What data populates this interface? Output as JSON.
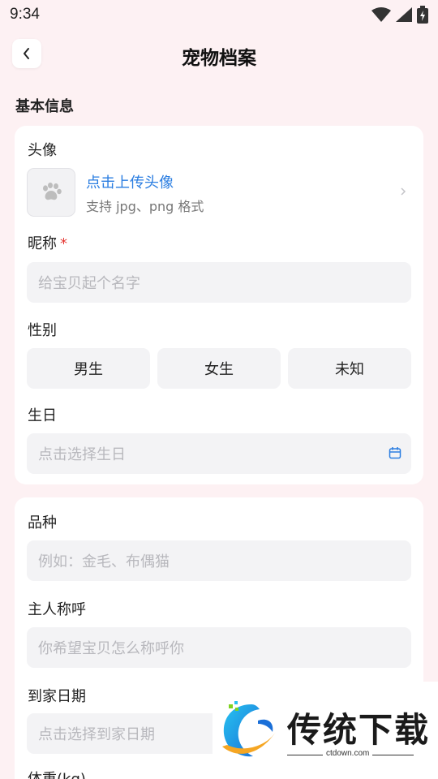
{
  "status_bar": {
    "time": "9:34"
  },
  "header": {
    "title": "宠物档案"
  },
  "section": {
    "title": "基本信息"
  },
  "avatar": {
    "label": "头像",
    "upload_text": "点击上传头像",
    "hint": "支持 jpg、png 格式"
  },
  "nickname": {
    "label": "昵称",
    "required_mark": "*",
    "placeholder": "给宝贝起个名字"
  },
  "gender": {
    "label": "性别",
    "options": [
      "男生",
      "女生",
      "未知"
    ]
  },
  "birthday": {
    "label": "生日",
    "placeholder": "点击选择生日"
  },
  "breed": {
    "label": "品种",
    "placeholder": "例如：金毛、布偶猫"
  },
  "owner_title": {
    "label": "主人称呼",
    "placeholder": "你希望宝贝怎么称呼你"
  },
  "arrival_date": {
    "label": "到家日期",
    "placeholder": "点击选择到家日期"
  },
  "weight": {
    "label": "体重(kg)"
  },
  "watermark": {
    "text": "传统下载",
    "url": "ctdown.com"
  },
  "colors": {
    "background": "#fdf1f3",
    "accent_blue": "#2a7de1",
    "required_red": "#e53935"
  },
  "icons": [
    "back-chevron-icon",
    "wifi-icon",
    "signal-icon",
    "battery-icon",
    "paw-icon",
    "chevron-right-icon",
    "calendar-icon"
  ]
}
